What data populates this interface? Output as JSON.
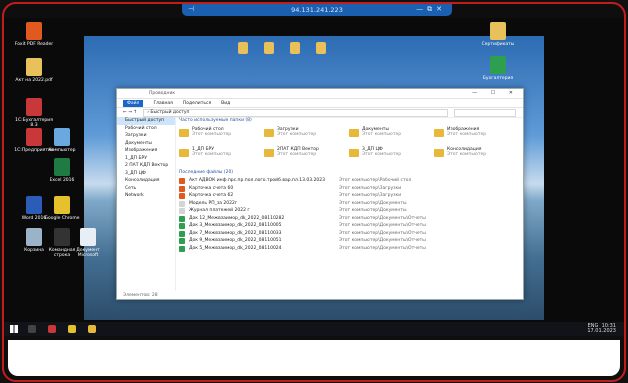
{
  "rdp": {
    "title": "94.131.241.223"
  },
  "desktop_icons": [
    {
      "label": "Foxit PDF Reader",
      "color": "#e05a20"
    },
    {
      "label": "Акт на 2022.pdf",
      "color": "#e8c15a"
    },
    {
      "label": "1С:Бухгалтерия 8.3",
      "color": "#c83838"
    },
    {
      "label": "1С:Предприятие",
      "color": "#c83838"
    },
    {
      "label": "Компьютер",
      "color": "#6aa8e0"
    },
    {
      "label": "Excel 2016",
      "color": "#1f7a43"
    },
    {
      "label": "Word 2016",
      "color": "#2b5db8"
    },
    {
      "label": "Google Chrome",
      "color": "#e6c12e"
    },
    {
      "label": "Командная строка",
      "color": "#333333"
    },
    {
      "label": "Корзина",
      "color": "#9ab3c8"
    },
    {
      "label": "Документ Microsoft",
      "color": "#e8eef5"
    },
    {
      "label": "Сертификаты",
      "color": "#e8c15a"
    },
    {
      "label": "Бухгалтерия",
      "color": "#2e9e4f"
    }
  ],
  "explorer": {
    "title": "Проводник",
    "controls": "— ☐ ✕",
    "ribbon": [
      "Файл",
      "Главная",
      "Поделиться",
      "Вид"
    ],
    "path": "› Быстрый доступ",
    "nav": [
      "Быстрый доступ",
      "Рабочий стол",
      "Загрузки",
      "Документы",
      "Изображения",
      "1_ДП БРУ",
      "2 ПАТ КДП Вектор",
      "3_ДП ЦФ",
      "Консолидация",
      "Сеть",
      "Network"
    ],
    "frequent_header": "Часто используемые папки (8)",
    "folders": [
      {
        "name": "Рабочий стол",
        "sub": "Этот компьютер"
      },
      {
        "name": "Загрузки",
        "sub": "Этот компьютер"
      },
      {
        "name": "Документы",
        "sub": "Этот компьютер"
      },
      {
        "name": "Изображения",
        "sub": "Этот компьютер"
      },
      {
        "name": "1_ДП БРУ",
        "sub": "Этот компьютер"
      },
      {
        "name": "2ПАТ КДП Вектор",
        "sub": "Этот компьютер"
      },
      {
        "name": "3_ДП ЦФ",
        "sub": "Этот компьютер"
      },
      {
        "name": "Консолидация",
        "sub": "Этот компьютер"
      }
    ],
    "recent_header": "Последние файлы (20)",
    "files": [
      {
        "name": "Акт АДВОК инф.прс.пр.пол.лого.тройб.вар.пл.13.03.2023",
        "loc": "Этот компьютер\\Рабочий стол",
        "color": "#e05a20"
      },
      {
        "name": "Карточка счета 60",
        "loc": "Этот компьютер\\Загрузки",
        "color": "#e05a20"
      },
      {
        "name": "Карточка счета 62",
        "loc": "Этот компьютер\\Загрузки",
        "color": "#e05a20"
      },
      {
        "name": "Модель РП_за 2022г",
        "loc": "Этот компьютер\\Документы",
        "color": "#d4d4d4"
      },
      {
        "name": "Журнал платежей 2022 г",
        "loc": "Этот компьютер\\Документы",
        "color": "#d4d4d4"
      },
      {
        "name": "Док 12_Межвзаимор_dk_2022_08110282",
        "loc": "Этот компьютер\\Документы\\Отчеты",
        "color": "#2e9e4f"
      },
      {
        "name": "Док 3_Межвзаимор_dk_2022_08110005",
        "loc": "Этот компьютер\\Документы\\Отчеты",
        "color": "#2e9e4f"
      },
      {
        "name": "Док 7_Межвзаимор_dk_2022_08110033",
        "loc": "Этот компьютер\\Документы\\Отчеты",
        "color": "#2e9e4f"
      },
      {
        "name": "Док 9_Межвзаимор_dk_2022_08110051",
        "loc": "Этот компьютер\\Документы\\Отчеты",
        "color": "#2e9e4f"
      },
      {
        "name": "Док 5_Межвзаимор_dk_2022_08110024",
        "loc": "Этот компьютер\\Документы\\Отчеты",
        "color": "#2e9e4f"
      }
    ],
    "status": "Элементов: 28"
  },
  "taskbar": {
    "lang": "ENG",
    "time": "10:31",
    "date": "17.01.2023"
  }
}
